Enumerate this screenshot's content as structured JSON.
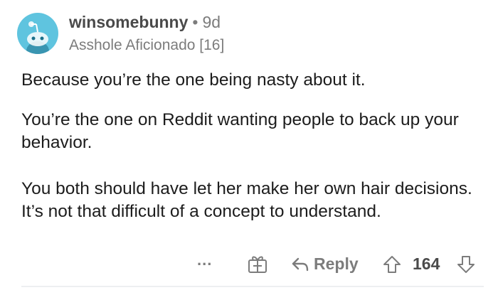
{
  "comment": {
    "username": "winsomebunny",
    "separator": "•",
    "age": "9d",
    "flair": "Asshole Aficionado [16]",
    "paragraphs": [
      "Because you’re the one being nasty about it.",
      "You’re the one on Reddit wanting people to back up your behavior.",
      "You both should have let her make her own hair decisions. It’s not that difficult of a concept to understand."
    ]
  },
  "actions": {
    "more_label": "...",
    "reply_label": "Reply",
    "score": "164"
  },
  "icons": {
    "avatar": "reddit-snoo-avatar",
    "award": "gift-award-icon",
    "reply": "reply-arrow-icon",
    "upvote": "upvote-arrow-icon",
    "downvote": "downvote-arrow-icon"
  },
  "colors": {
    "avatar_bg": "#5fc4df",
    "text": "#1c1c1c",
    "muted": "#7c7c7c"
  }
}
